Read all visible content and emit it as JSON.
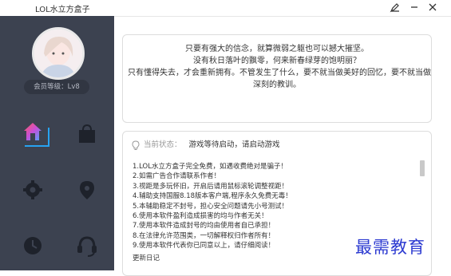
{
  "window": {
    "title": "LOL水立方盒子",
    "icons": [
      "skin-icon",
      "minimize-icon",
      "close-icon"
    ]
  },
  "sidebar": {
    "member_level": "会员等级：Lv8",
    "nav_items": [
      {
        "icon": "home-icon",
        "active": true
      },
      {
        "icon": "shopping-bag-icon",
        "active": false
      },
      {
        "icon": "settings-gear-icon",
        "active": false
      },
      {
        "icon": "location-pin-icon",
        "active": false
      },
      {
        "icon": "clock-icon",
        "active": false
      },
      {
        "icon": "headset-icon",
        "active": false
      }
    ]
  },
  "motto": {
    "lines": [
      "只要有强大的信念，就算微弱之躯也可以撼大摧坚。",
      "没有秋日落叶的飘零，何来新春绿芽的饱明丽？",
      "只有懂得失去，才会重新拥有。不管发生了什么，要不就当做美好的回忆，要不就当做",
      "深刻的教训。"
    ]
  },
  "status": {
    "label": "当前状态：",
    "text": "游戏等待启动，请启动游戏"
  },
  "notice": {
    "lines": [
      "1.LOL水立方盒子完全免费，如遇收费绝对是骗子！",
      "2.如需广告合作请联系作者！",
      "3.视距是多玩怀旧，开启后请用鼠标滚轮调整视距！",
      "4.辅助支持国服8.18版本客户端,程序永久免费无毒！",
      "5.本辅助稳定不封号，担心安全问题请先小号测试！",
      "6.使用本软件盈利造成损害的均与作者无关！",
      "7.使用本软件造成封号的均由使用者自已承担！",
      "8.在法律允许范围类，一切解释权归作者所有！",
      "9.使用本软件代表你已同意以上，请仔细阅读！"
    ],
    "changelog_label": "更新日记"
  },
  "watermark": "最需教育"
}
